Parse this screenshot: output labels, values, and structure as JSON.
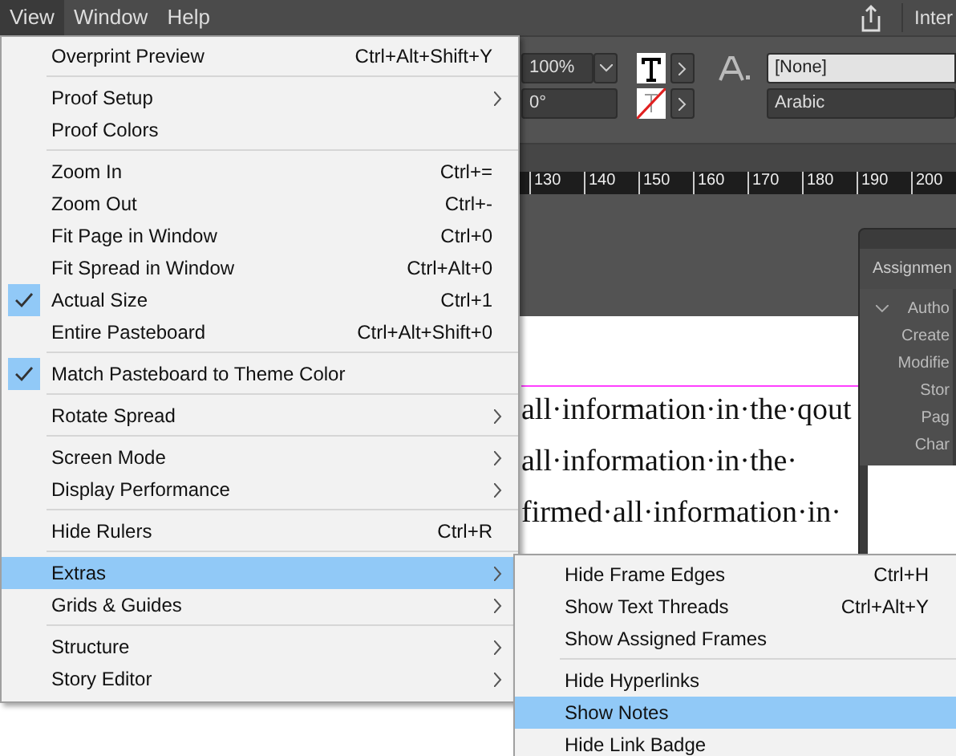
{
  "menubar": [
    {
      "label": "View",
      "selected": true
    },
    {
      "label": "Window",
      "selected": false
    },
    {
      "label": "Help",
      "selected": false
    }
  ],
  "workspace": "Inter",
  "control_bar": {
    "zoom": "100%",
    "angle": "0°",
    "style": "[None]",
    "language": "Arabic"
  },
  "ruler": [
    "130",
    "140",
    "150",
    "160",
    "170",
    "180",
    "190",
    "200"
  ],
  "assignments_panel": {
    "title": "Assignmen",
    "rows": [
      {
        "label": "Autho",
        "kind": "header"
      },
      {
        "label": "Create",
        "kind": "field"
      },
      {
        "label": "Modifie",
        "kind": "field"
      },
      {
        "label": "Stor",
        "kind": "field"
      },
      {
        "label": "Pag",
        "kind": "field"
      },
      {
        "label": "Char",
        "kind": "field"
      }
    ]
  },
  "page_text": [
    "all·information·in·the·qout",
    "all·information·in·the·",
    "firmed·all·information·in·"
  ],
  "view_menu": {
    "items": [
      {
        "kind": "item",
        "label": "Overprint Preview",
        "shortcut": "Ctrl+Alt+Shift+Y",
        "checked": false,
        "submenu": false,
        "selected": false
      },
      {
        "kind": "separator"
      },
      {
        "kind": "item",
        "label": "Proof Setup",
        "checked": false,
        "submenu": true,
        "selected": false
      },
      {
        "kind": "item",
        "label": "Proof Colors",
        "checked": false,
        "submenu": false,
        "selected": false
      },
      {
        "kind": "separator"
      },
      {
        "kind": "item",
        "label": "Zoom In",
        "shortcut": "Ctrl+=",
        "checked": false,
        "submenu": false,
        "selected": false
      },
      {
        "kind": "item",
        "label": "Zoom Out",
        "shortcut": "Ctrl+-",
        "checked": false,
        "submenu": false,
        "selected": false
      },
      {
        "kind": "item",
        "label": "Fit Page in Window",
        "shortcut": "Ctrl+0",
        "checked": false,
        "submenu": false,
        "selected": false
      },
      {
        "kind": "item",
        "label": "Fit Spread in Window",
        "shortcut": "Ctrl+Alt+0",
        "checked": false,
        "submenu": false,
        "selected": false
      },
      {
        "kind": "item",
        "label": "Actual Size",
        "shortcut": "Ctrl+1",
        "checked": true,
        "submenu": false,
        "selected": false
      },
      {
        "kind": "item",
        "label": "Entire Pasteboard",
        "shortcut": "Ctrl+Alt+Shift+0",
        "checked": false,
        "submenu": false,
        "selected": false
      },
      {
        "kind": "separator"
      },
      {
        "kind": "item",
        "label": "Match Pasteboard to Theme Color",
        "checked": true,
        "submenu": false,
        "selected": false
      },
      {
        "kind": "separator"
      },
      {
        "kind": "item",
        "label": "Rotate Spread",
        "checked": false,
        "submenu": true,
        "selected": false
      },
      {
        "kind": "separator"
      },
      {
        "kind": "item",
        "label": "Screen Mode",
        "checked": false,
        "submenu": true,
        "selected": false
      },
      {
        "kind": "item",
        "label": "Display Performance",
        "checked": false,
        "submenu": true,
        "selected": false
      },
      {
        "kind": "separator"
      },
      {
        "kind": "item",
        "label": "Hide Rulers",
        "shortcut": "Ctrl+R",
        "checked": false,
        "submenu": false,
        "selected": false
      },
      {
        "kind": "separator"
      },
      {
        "kind": "item",
        "label": "Extras",
        "checked": false,
        "submenu": true,
        "selected": true
      },
      {
        "kind": "item",
        "label": "Grids & Guides",
        "checked": false,
        "submenu": true,
        "selected": false
      },
      {
        "kind": "separator"
      },
      {
        "kind": "item",
        "label": "Structure",
        "checked": false,
        "submenu": true,
        "selected": false
      },
      {
        "kind": "item",
        "label": "Story Editor",
        "checked": false,
        "submenu": true,
        "selected": false
      }
    ]
  },
  "extras_submenu": {
    "items": [
      {
        "kind": "item",
        "label": "Hide Frame Edges",
        "shortcut": "Ctrl+H",
        "selected": false
      },
      {
        "kind": "item",
        "label": "Show Text Threads",
        "shortcut": "Ctrl+Alt+Y",
        "selected": false
      },
      {
        "kind": "item",
        "label": "Show Assigned Frames",
        "selected": false
      },
      {
        "kind": "separator"
      },
      {
        "kind": "item",
        "label": "Hide Hyperlinks",
        "selected": false
      },
      {
        "kind": "item",
        "label": "Show Notes",
        "selected": true
      },
      {
        "kind": "item",
        "label": "Hide Link Badge",
        "selected": false
      }
    ]
  }
}
